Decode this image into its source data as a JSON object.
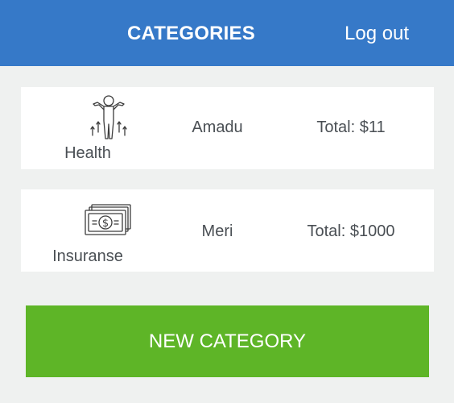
{
  "header": {
    "title": "CATEGORIES",
    "logout_label": "Log out",
    "color": "#3679c8"
  },
  "categories": [
    {
      "name": "Health",
      "user": "Amadu",
      "total": "Total: $11",
      "icon": "person-arrows-up-icon"
    },
    {
      "name": "Insuranse",
      "user": "Meri",
      "total": "Total: $1000",
      "icon": "money-stack-icon"
    }
  ],
  "new_category": {
    "label": "NEW CATEGORY",
    "color": "#5eb527"
  },
  "background": "#eff1f0"
}
